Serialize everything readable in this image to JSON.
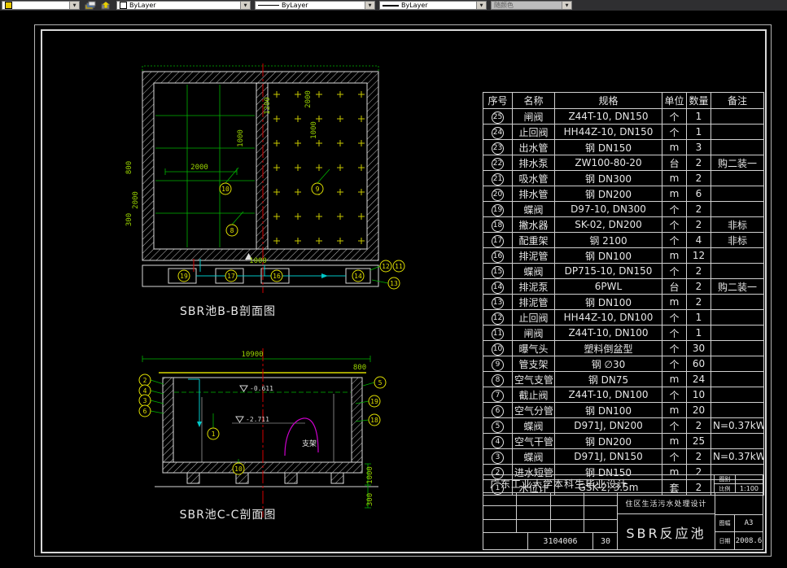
{
  "toolbar": {
    "color": "ByLayer",
    "linetype": "ByLayer",
    "lineweight": "ByLayer",
    "plot_style": "随颜色",
    "icons": [
      "layer-properties-icon",
      "layer-states-icon"
    ]
  },
  "colors": {
    "dim_green": "#00b400",
    "callout_yellow": "#dede00",
    "centerline_red": "#d40000",
    "pipe_cyan": "#00c8c8",
    "pipe_magenta": "#cc00cc",
    "linework_white": "#d8d8d8"
  },
  "drawings": {
    "bb": {
      "label": "SBR池B-B剖面图",
      "callouts": [
        "10",
        "9",
        "8",
        "19",
        "17",
        "16",
        "14",
        "12",
        "11",
        "13"
      ],
      "dims": [
        "2000",
        "1000",
        "800",
        "2000",
        "300",
        "1000",
        "1200",
        "1000",
        "2000"
      ]
    },
    "cc": {
      "label": "SBR池C-C剖面图",
      "callouts": [
        "2",
        "4",
        "3",
        "6",
        "1",
        "5",
        "19",
        "18",
        "10"
      ],
      "dims": [
        "10900",
        "800",
        "1000",
        "300"
      ],
      "elevations": [
        "-0.611",
        "-2.711"
      ],
      "support_label": "支架"
    }
  },
  "table": {
    "headers": [
      "序号",
      "名称",
      "规格",
      "单位",
      "数量",
      "备注"
    ],
    "rows": [
      {
        "no": "25",
        "name": "闸阀",
        "spec": "Z44T-10, DN150",
        "unit": "个",
        "qty": "1",
        "note": ""
      },
      {
        "no": "24",
        "name": "止回阀",
        "spec": "HH44Z-10, DN150",
        "unit": "个",
        "qty": "1",
        "note": ""
      },
      {
        "no": "23",
        "name": "出水管",
        "spec": "钢  DN150",
        "unit": "m",
        "qty": "3",
        "note": ""
      },
      {
        "no": "22",
        "name": "排水泵",
        "spec": "ZW100-80-20",
        "unit": "台",
        "qty": "2",
        "note": "购二装一"
      },
      {
        "no": "21",
        "name": "吸水管",
        "spec": "钢  DN300",
        "unit": "m",
        "qty": "2",
        "note": ""
      },
      {
        "no": "20",
        "name": "排水管",
        "spec": "钢  DN200",
        "unit": "m",
        "qty": "6",
        "note": ""
      },
      {
        "no": "19",
        "name": "蝶阀",
        "spec": "D97-10, DN300",
        "unit": "个",
        "qty": "2",
        "note": ""
      },
      {
        "no": "18",
        "name": "撇水器",
        "spec": "SK-02, DN200",
        "unit": "个",
        "qty": "2",
        "note": "非标"
      },
      {
        "no": "17",
        "name": "配重架",
        "spec": "钢  2100",
        "unit": "个",
        "qty": "4",
        "note": "非标"
      },
      {
        "no": "16",
        "name": "排泥管",
        "spec": "钢  DN100",
        "unit": "m",
        "qty": "12",
        "note": ""
      },
      {
        "no": "15",
        "name": "蝶阀",
        "spec": "DP715-10, DN150",
        "unit": "个",
        "qty": "2",
        "note": ""
      },
      {
        "no": "14",
        "name": "排泥泵",
        "spec": "6PWL",
        "unit": "台",
        "qty": "2",
        "note": "购二装一"
      },
      {
        "no": "13",
        "name": "排泥管",
        "spec": "钢  DN100",
        "unit": "m",
        "qty": "2",
        "note": ""
      },
      {
        "no": "12",
        "name": "止回阀",
        "spec": "HH44Z-10, DN100",
        "unit": "个",
        "qty": "1",
        "note": ""
      },
      {
        "no": "11",
        "name": "闸阀",
        "spec": "Z44T-10, DN100",
        "unit": "个",
        "qty": "1",
        "note": ""
      },
      {
        "no": "10",
        "name": "曝气头",
        "spec": "塑料倒盆型",
        "unit": "个",
        "qty": "30",
        "note": ""
      },
      {
        "no": "9",
        "name": "管支架",
        "spec": "钢  ∅30",
        "unit": "个",
        "qty": "60",
        "note": ""
      },
      {
        "no": "8",
        "name": "空气支管",
        "spec": "钢  DN75",
        "unit": "m",
        "qty": "24",
        "note": ""
      },
      {
        "no": "7",
        "name": "截止阀",
        "spec": "Z44T-10, DN100",
        "unit": "个",
        "qty": "10",
        "note": ""
      },
      {
        "no": "6",
        "name": "空气分管",
        "spec": "钢  DN100",
        "unit": "m",
        "qty": "20",
        "note": ""
      },
      {
        "no": "5",
        "name": "蝶阀",
        "spec": "D971J, DN200",
        "unit": "个",
        "qty": "2",
        "note": "N=0.37kW"
      },
      {
        "no": "4",
        "name": "空气干管",
        "spec": "钢  DN200",
        "unit": "m",
        "qty": "25",
        "note": ""
      },
      {
        "no": "3",
        "name": "蝶阀",
        "spec": "D971J, DN150",
        "unit": "个",
        "qty": "2",
        "note": "N=0.37kW"
      },
      {
        "no": "2",
        "name": "进水短管",
        "spec": "钢  DN150",
        "unit": "m",
        "qty": "2",
        "note": ""
      },
      {
        "no": "1",
        "name": "水位计",
        "spec": "GSK-2, 3.5m",
        "unit": "套",
        "qty": "2",
        "note": ""
      }
    ]
  },
  "titleblock": {
    "university": "广东工业大学本科生毕业设计",
    "category_label": "图别",
    "category_value": "",
    "scale_label": "比例",
    "scale": "1:100",
    "project": "住区生活污水处理设计",
    "drawing_name": "SBR反应池",
    "sheet_label": "图幅",
    "sheet": "A3",
    "date_label": "日期",
    "date": "2008.6",
    "number": "3104006",
    "number2": "30"
  }
}
